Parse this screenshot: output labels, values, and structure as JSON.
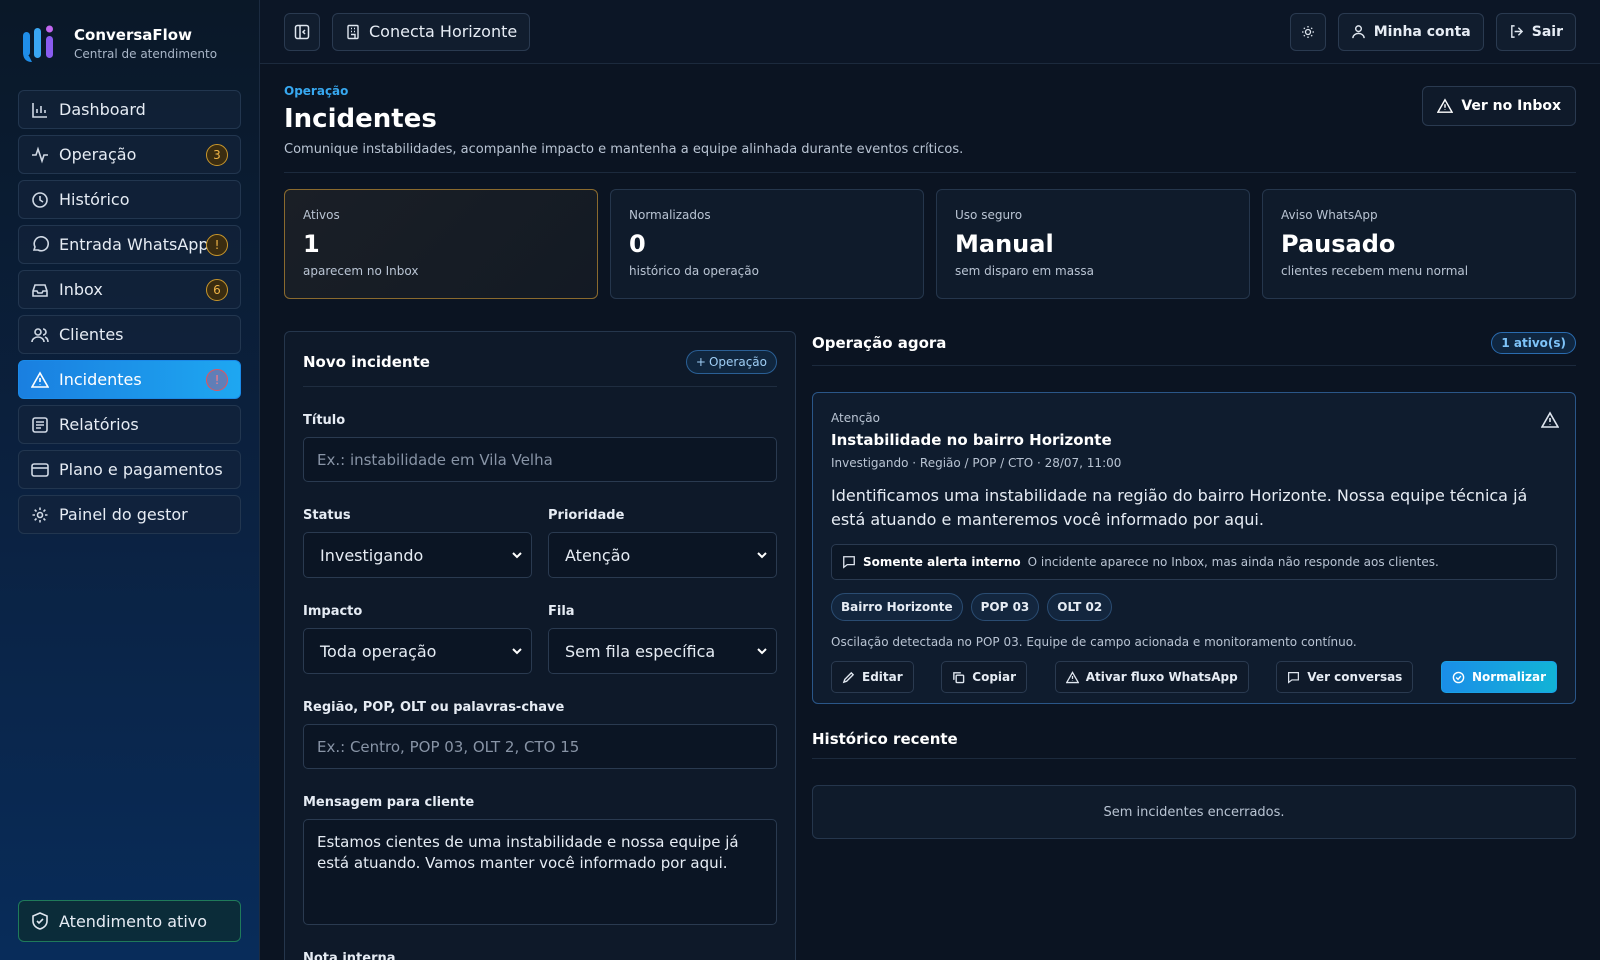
{
  "brand": {
    "title": "ConversaFlow",
    "subtitle": "Central de atendimento"
  },
  "sidebar": {
    "items": [
      {
        "label": "Dashboard",
        "icon": "chart-bar-icon"
      },
      {
        "label": "Operação",
        "icon": "activity-icon",
        "badge": "3"
      },
      {
        "label": "Histórico",
        "icon": "clock-icon"
      },
      {
        "label": "Entrada WhatsApp",
        "icon": "chat-bubble-icon",
        "badge": "!"
      },
      {
        "label": "Inbox",
        "icon": "inbox-icon",
        "badge": "6"
      },
      {
        "label": "Clientes",
        "icon": "users-icon"
      },
      {
        "label": "Incidentes",
        "icon": "alert-triangle-icon",
        "badge": "!",
        "active": true
      },
      {
        "label": "Relatórios",
        "icon": "report-icon"
      },
      {
        "label": "Plano e pagamentos",
        "icon": "credit-card-icon"
      },
      {
        "label": "Painel do gestor",
        "icon": "gear-icon"
      }
    ],
    "footer_label": "Atendimento ativo"
  },
  "topbar": {
    "workspace": "Conecta Horizonte",
    "account": "Minha conta",
    "logout": "Sair"
  },
  "header": {
    "eyebrow": "Operação",
    "title": "Incidentes",
    "description": "Comunique instabilidades, acompanhe impacto e mantenha a equipe alinhada durante eventos críticos.",
    "inbox_button": "Ver no Inbox"
  },
  "stats": [
    {
      "label": "Ativos",
      "value": "1",
      "sub": "aparecem no Inbox"
    },
    {
      "label": "Normalizados",
      "value": "0",
      "sub": "histórico da operação"
    },
    {
      "label": "Uso seguro",
      "value": "Manual",
      "sub": "sem disparo em massa"
    },
    {
      "label": "Aviso WhatsApp",
      "value": "Pausado",
      "sub": "clientes recebem menu normal"
    }
  ],
  "form": {
    "title": "Novo incidente",
    "pill": "Operação",
    "title_label": "Título",
    "title_placeholder": "Ex.: instabilidade em Vila Velha",
    "status_label": "Status",
    "status_value": "Investigando",
    "priority_label": "Prioridade",
    "priority_value": "Atenção",
    "impact_label": "Impacto",
    "impact_value": "Toda operação",
    "queue_label": "Fila",
    "queue_value": "Sem fila específica",
    "region_label": "Região, POP, OLT ou palavras-chave",
    "region_placeholder": "Ex.: Centro, POP 03, OLT 2, CTO 15",
    "message_label": "Mensagem para cliente",
    "message_value": "Estamos cientes de uma instabilidade e nossa equipe já está atuando. Vamos manter você informado por aqui.",
    "note_label": "Nota interna"
  },
  "operation": {
    "title": "Operação agora",
    "count": "1 ativo(s)",
    "incident": {
      "level": "Atenção",
      "title": "Instabilidade no bairro Horizonte",
      "meta": "Investigando · Região / POP / CTO · 28/07, 11:00",
      "message": "Identificamos uma instabilidade na região do bairro Horizonte. Nossa equipe técnica já está atuando e manteremos você informado por aqui.",
      "alert_bold": "Somente alerta interno",
      "alert_text": "O incidente aparece no Inbox, mas ainda não responde aos clientes.",
      "tags": [
        "Bairro Horizonte",
        "POP 03",
        "OLT 02"
      ],
      "note": "Oscilação detectada no POP 03. Equipe de campo acionada e monitoramento contínuo.",
      "actions": {
        "edit": "Editar",
        "copy": "Copiar",
        "whatsapp": "Ativar fluxo WhatsApp",
        "conversations": "Ver conversas",
        "normalize": "Normalizar"
      }
    }
  },
  "history": {
    "title": "Histórico recente",
    "empty": "Sem incidentes encerrados."
  }
}
